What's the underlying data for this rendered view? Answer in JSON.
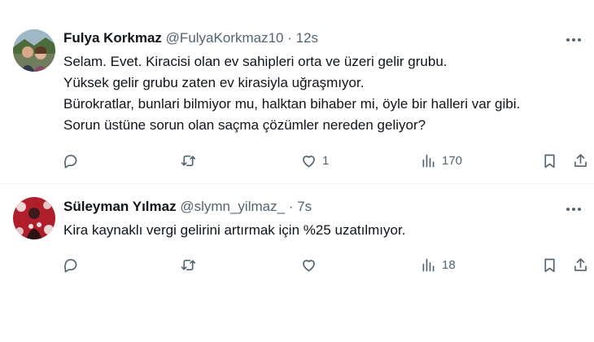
{
  "tweets": [
    {
      "author_name": "Fulya Korkmaz",
      "handle": "@FulyaKorkmaz10",
      "separator": "·",
      "time": "12s",
      "lines": [
        "Selam. Evet. Kiracisi olan ev sahipleri orta ve üzeri gelir grubu.",
        "Yüksek gelir grubu zaten ev kirasiyla uğraşmıyor.",
        "Bürokratlar, bunlari bilmiyor mu, halktan bihaber mi, öyle bir halleri var gibi.",
        "Sorun üstüne sorun olan saçma çözümler nereden geliyor?"
      ],
      "likes": "1",
      "views": "170"
    },
    {
      "author_name": "Süleyman Yılmaz",
      "handle": "@slymn_yilmaz_",
      "separator": "·",
      "time": "7s",
      "lines": [
        "Kira kaynaklı vergi gelirini artırmak için %25 uzatılmıyor."
      ],
      "likes": "",
      "views": "18"
    }
  ],
  "colors": {
    "text": "#0f1419",
    "secondary": "#536471",
    "divider": "#eff3f4"
  },
  "icons": [
    "reply-icon",
    "retweet-icon",
    "like-icon",
    "views-icon",
    "bookmark-icon",
    "share-icon",
    "more-icon"
  ]
}
